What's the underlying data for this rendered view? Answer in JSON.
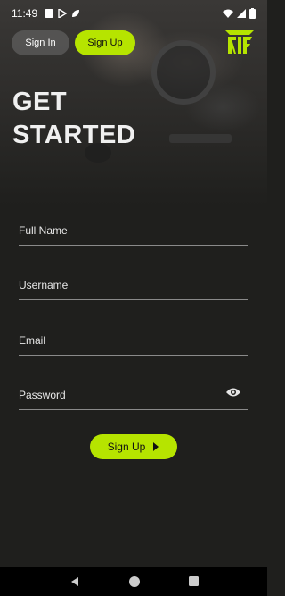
{
  "status_bar": {
    "time": "11:49",
    "icons": [
      "square-icon",
      "play-store-icon",
      "leaf-icon"
    ],
    "right_icons": [
      "wifi-icon",
      "signal-icon",
      "battery-icon"
    ]
  },
  "top_nav": {
    "signin_label": "Sign In",
    "signup_label": "Sign Up",
    "logo": "rtf-logo"
  },
  "hero": {
    "title_line1": "GET",
    "title_line2": "STARTED"
  },
  "form": {
    "full_name": {
      "placeholder": "Full Name",
      "value": ""
    },
    "username": {
      "placeholder": "Username",
      "value": ""
    },
    "email": {
      "placeholder": "Email",
      "value": ""
    },
    "password": {
      "placeholder": "Password",
      "value": ""
    },
    "submit_label": "Sign Up"
  },
  "nav_bar": {
    "buttons": [
      "back-icon",
      "home-icon",
      "recents-icon"
    ]
  },
  "colors": {
    "accent": "#b6e400",
    "background": "#1f1f1d"
  }
}
